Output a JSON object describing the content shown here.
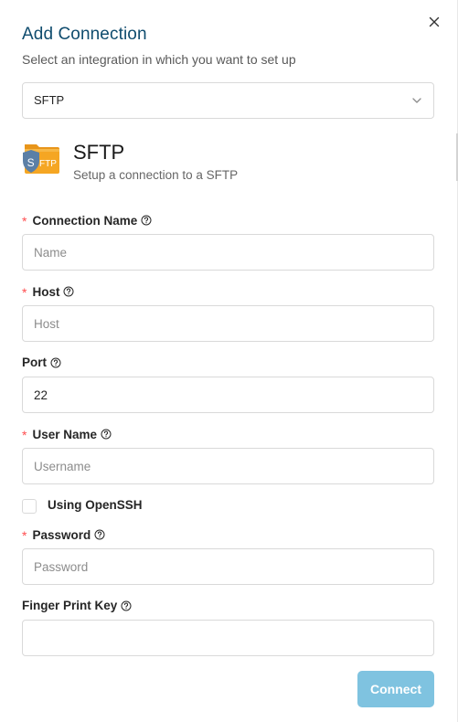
{
  "dialog": {
    "title": "Add Connection",
    "subtitle": "Select an integration in which you want to set up",
    "close_icon": "close-icon"
  },
  "integration_select": {
    "value": "SFTP",
    "icon": "chevron-down-icon"
  },
  "integration": {
    "name": "SFTP",
    "description": "Setup a connection to a SFTP",
    "icon": "sftp-folder-icon",
    "icon_badge_letter": "S",
    "icon_text": "FTP",
    "folder_color": "#f5a623",
    "badge_color": "#5b7fa6"
  },
  "form": {
    "connection_name": {
      "label": "Connection Name",
      "required": true,
      "placeholder": "Name",
      "value": ""
    },
    "host": {
      "label": "Host",
      "required": true,
      "placeholder": "Host",
      "value": ""
    },
    "port": {
      "label": "Port",
      "required": false,
      "placeholder": "",
      "value": "22"
    },
    "user_name": {
      "label": "User Name",
      "required": true,
      "placeholder": "Username",
      "value": ""
    },
    "using_openssh": {
      "label": "Using OpenSSH",
      "checked": false
    },
    "password": {
      "label": "Password",
      "required": true,
      "placeholder": "Password",
      "value": ""
    },
    "finger_print_key": {
      "label": "Finger Print Key",
      "required": false,
      "placeholder": "",
      "value": ""
    },
    "required_marker": "*"
  },
  "actions": {
    "connect_label": "Connect"
  },
  "colors": {
    "title": "#0f4c6e",
    "required": "#ff4d4f",
    "primary_disabled": "#7fc3e0"
  }
}
